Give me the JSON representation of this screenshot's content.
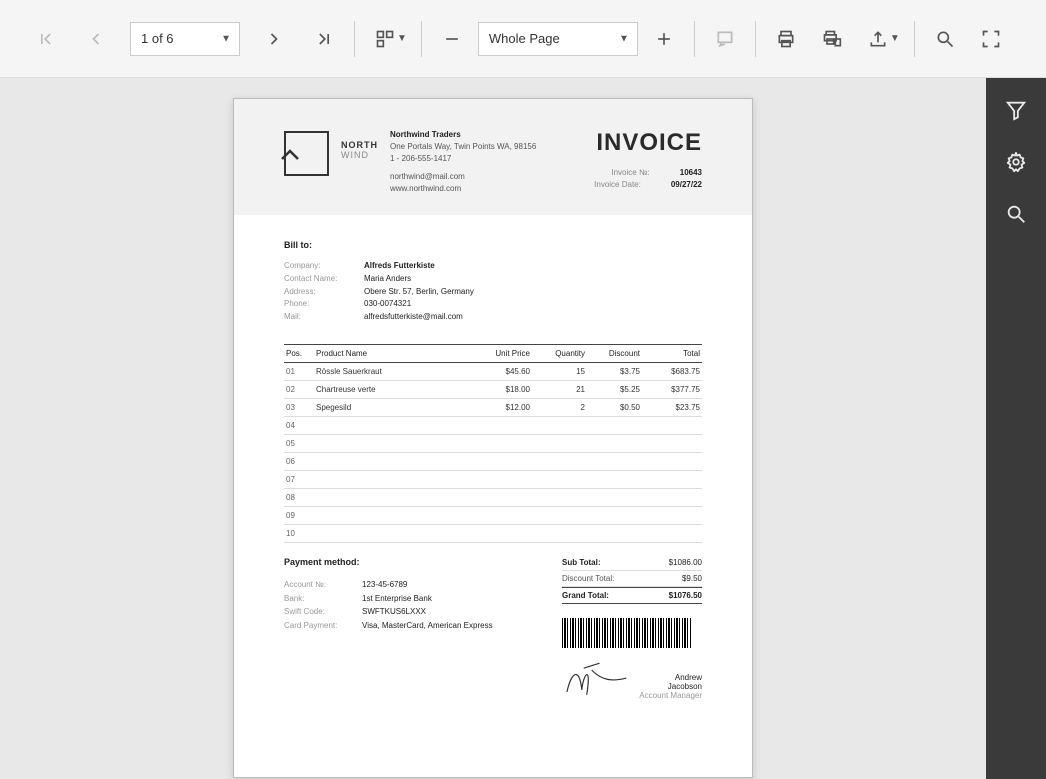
{
  "toolbar": {
    "page_indicator": "1 of 6",
    "zoom_mode": "Whole Page"
  },
  "company": {
    "logo_line1": "NORTH",
    "logo_line2": "WIND",
    "name": "Northwind Traders",
    "address": "One Portals Way, Twin Points WA, 98156",
    "phone": "1 - 206-555-1417",
    "email": "northwind@mail.com",
    "web": "www.northwind.com"
  },
  "invoice": {
    "title": "INVOICE",
    "num_label": "Invoice №:",
    "num": "10643",
    "date_label": "Invoice Date:",
    "date": "09/27/22"
  },
  "billto": {
    "title": "Bill to:",
    "company_label": "Company:",
    "company": "Alfreds Futterkiste",
    "contact_label": "Contact Name:",
    "contact": "Maria Anders",
    "address_label": "Address:",
    "address": "Obere Str. 57, Berlin, Germany",
    "phone_label": "Phone:",
    "phone": "030-0074321",
    "mail_label": "Mail:",
    "mail": "alfredsfutterkiste@mail.com"
  },
  "table": {
    "headers": {
      "pos": "Pos.",
      "product": "Product Name",
      "unit": "Unit Price",
      "qty": "Quantity",
      "discount": "Discount",
      "total": "Total"
    },
    "rows": [
      {
        "pos": "01",
        "product": "Rössle Sauerkraut",
        "unit": "$45.60",
        "qty": "15",
        "discount": "$3.75",
        "total": "$683.75"
      },
      {
        "pos": "02",
        "product": "Chartreuse verte",
        "unit": "$18.00",
        "qty": "21",
        "discount": "$5.25",
        "total": "$377.75"
      },
      {
        "pos": "03",
        "product": "Spegesild",
        "unit": "$12.00",
        "qty": "2",
        "discount": "$0.50",
        "total": "$23.75"
      },
      {
        "pos": "04",
        "product": "",
        "unit": "",
        "qty": "",
        "discount": "",
        "total": ""
      },
      {
        "pos": "05",
        "product": "",
        "unit": "",
        "qty": "",
        "discount": "",
        "total": ""
      },
      {
        "pos": "06",
        "product": "",
        "unit": "",
        "qty": "",
        "discount": "",
        "total": ""
      },
      {
        "pos": "07",
        "product": "",
        "unit": "",
        "qty": "",
        "discount": "",
        "total": ""
      },
      {
        "pos": "08",
        "product": "",
        "unit": "",
        "qty": "",
        "discount": "",
        "total": ""
      },
      {
        "pos": "09",
        "product": "",
        "unit": "",
        "qty": "",
        "discount": "",
        "total": ""
      },
      {
        "pos": "10",
        "product": "",
        "unit": "",
        "qty": "",
        "discount": "",
        "total": ""
      }
    ]
  },
  "totals": {
    "sub_label": "Sub Total:",
    "sub": "$1086.00",
    "disc_label": "Discount Total:",
    "disc": "$9.50",
    "grand_label": "Grand Total:",
    "grand": "$1076.50"
  },
  "payment": {
    "title": "Payment method:",
    "acct_label": "Account №:",
    "acct": "123-45-6789",
    "bank_label": "Bank:",
    "bank": "1st Enterprise Bank",
    "swift_label": "Swift Code:",
    "swift": "SWFTKUS6LXXX",
    "card_label": "Card Payment:",
    "card": "Visa, MasterCard, American Express"
  },
  "signature": {
    "name": "Andrew Jacobson",
    "role": "Account Manager"
  }
}
